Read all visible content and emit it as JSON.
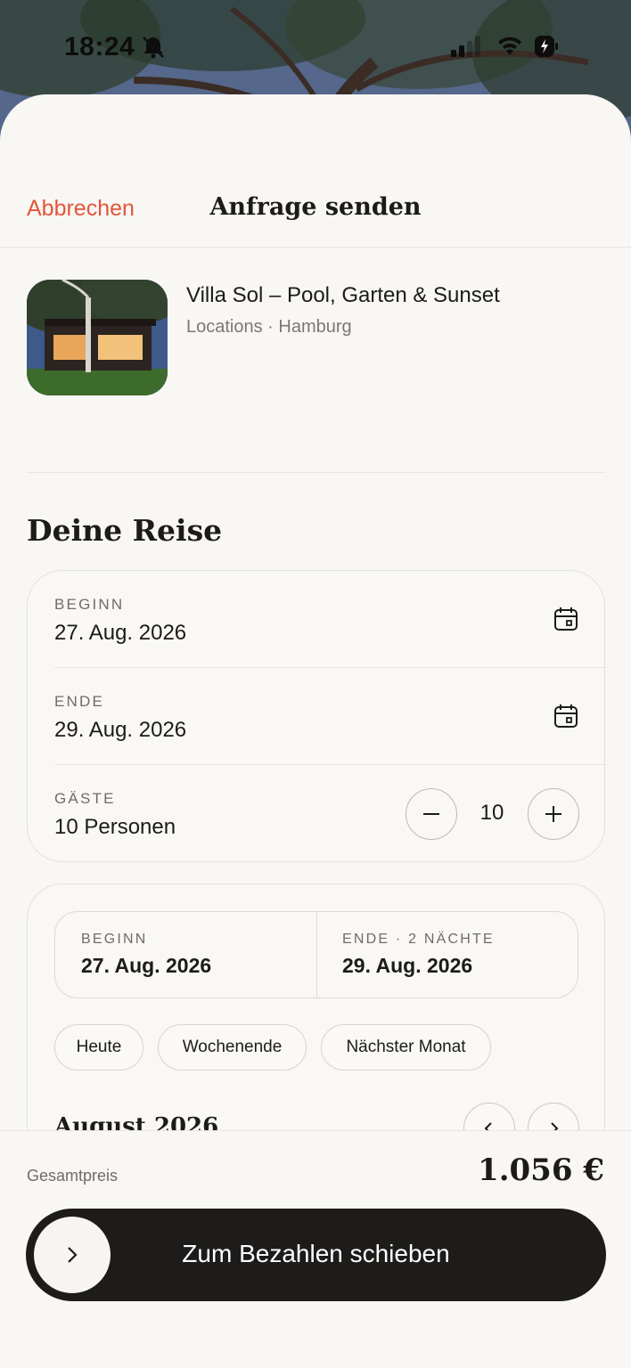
{
  "status_bar": {
    "time": "18:24",
    "icons": [
      "bell-slash-icon",
      "signal-icon",
      "wifi-icon",
      "battery-icon"
    ]
  },
  "nav": {
    "cancel_label": "Abbrechen",
    "title": "Anfrage senden"
  },
  "listing": {
    "title": "Villa Sol – Pool, Garten & Sunset",
    "subtitle": "Locations · Hamburg"
  },
  "trip": {
    "section_title": "Deine Reise",
    "start": {
      "label": "BEGINN",
      "value": "27. Aug. 2026"
    },
    "end": {
      "label": "ENDE",
      "value": "29. Aug. 2026"
    },
    "guests": {
      "label": "GÄSTE",
      "value": "10 Personen",
      "count": "10"
    }
  },
  "calendar": {
    "range_start_label": "BEGINN",
    "range_start_value": "27. Aug. 2026",
    "range_end_label": "ENDE  ·  2 NÄCHTE",
    "range_end_value": "29. Aug. 2026",
    "chips": [
      "Heute",
      "Wochenende",
      "Nächster Monat"
    ],
    "month_title": "August 2026"
  },
  "footer": {
    "total_label": "Gesamtpreis",
    "total_value": "1.056 €",
    "slider_label": "Zum Bezahlen schieben"
  },
  "colors": {
    "accent": "#e2563a",
    "sheet_bg": "#f8f7f4",
    "slider_bg": "#1d1c1a"
  }
}
